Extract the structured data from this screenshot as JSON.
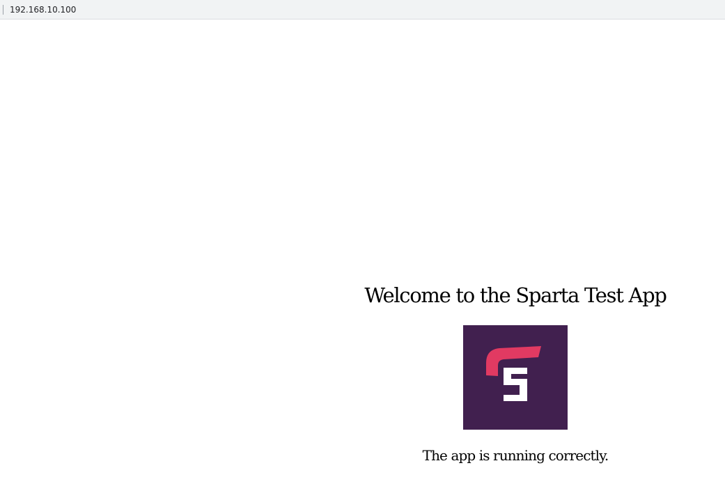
{
  "browser": {
    "url": "192.168.10.100"
  },
  "page": {
    "heading": "Welcome to the Sparta Test App",
    "status": "The app is running correctly."
  },
  "logo": {
    "icon": "sparta-s-logo-icon",
    "background_color": "#41204f",
    "accent_color": "#e13a62",
    "letter_color": "#ffffff"
  }
}
